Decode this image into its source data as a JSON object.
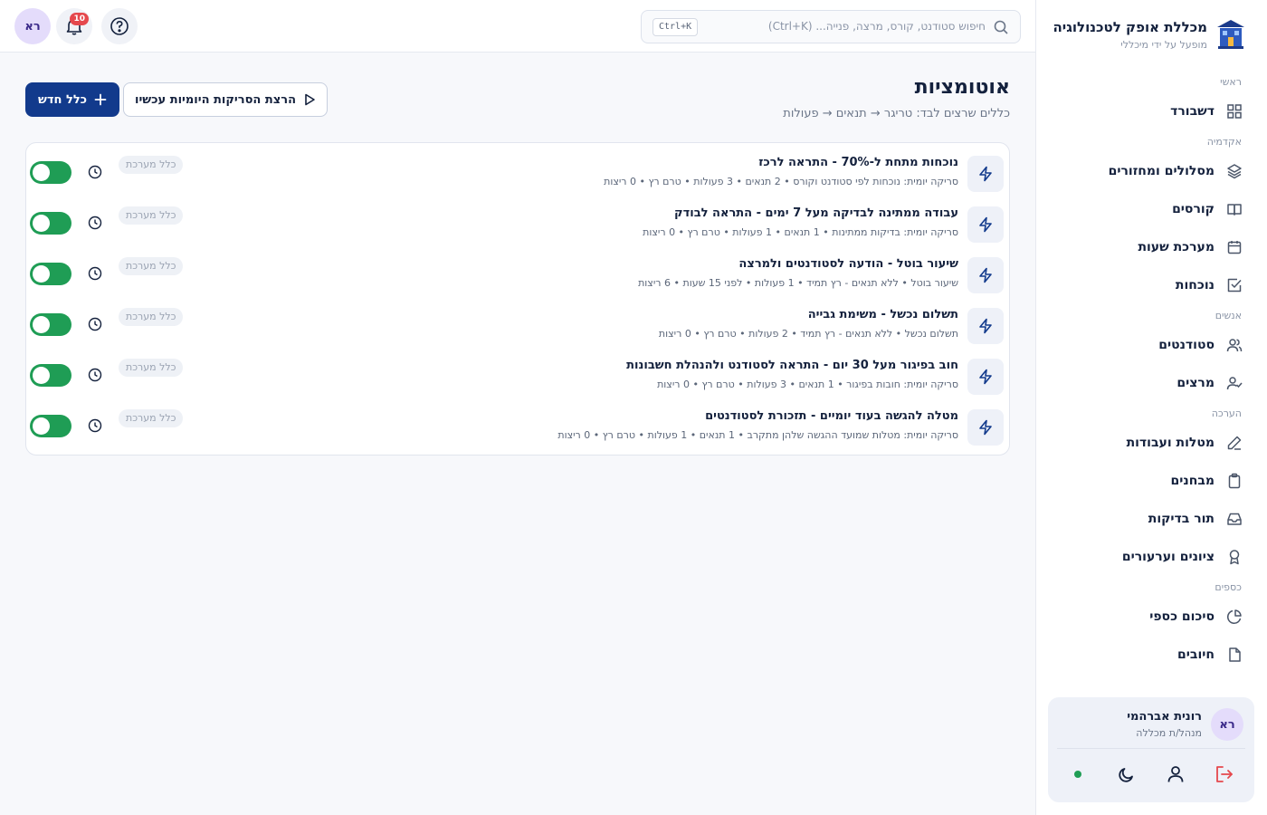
{
  "brand": {
    "title": "מכללת אופק לטכנולוגיה",
    "subtitle": "מופעל על ידי מיכללי"
  },
  "search": {
    "placeholder": "חיפוש סטודנט, קורס, מרצה, פנייה... (Ctrl+K)",
    "shortcut": "Ctrl+K"
  },
  "topbar": {
    "notifications_count": "10",
    "avatar_initials": "רא"
  },
  "page": {
    "title": "אוטומציות",
    "subtitle": "כללים שרצים לבד: טריגר → תנאים → פעולות"
  },
  "actions": {
    "new_rule": "כלל חדש",
    "run_scans": "הרצת הסריקות היומיות עכשיו"
  },
  "rules": [
    {
      "title": "נוכחות מתחת ל-70% - התראה לרכז",
      "meta": "סריקה יומית: נוכחות לפי סטודנט וקורס • 2 תנאים • 3 פעולות • טרם רץ • 0 ריצות",
      "badge": "כלל מערכת",
      "enabled": true
    },
    {
      "title": "עבודה ממתינה לבדיקה מעל 7 ימים - התראה לבודק",
      "meta": "סריקה יומית: בדיקות ממתינות • 1 תנאים • 1 פעולות • טרם רץ • 0 ריצות",
      "badge": "כלל מערכת",
      "enabled": true
    },
    {
      "title": "שיעור בוטל - הודעה לסטודנטים ולמרצה",
      "meta": "שיעור בוטל • ללא תנאים - רץ תמיד • 1 פעולות • לפני 15 שעות • 6 ריצות",
      "badge": "כלל מערכת",
      "enabled": true
    },
    {
      "title": "תשלום נכשל - משימת גבייה",
      "meta": "תשלום נכשל • ללא תנאים - רץ תמיד • 2 פעולות • טרם רץ • 0 ריצות",
      "badge": "כלל מערכת",
      "enabled": true
    },
    {
      "title": "חוב בפיגור מעל 30 יום - התראה לסטודנט ולהנהלת חשבונות",
      "meta": "סריקה יומית: חובות בפיגור • 1 תנאים • 3 פעולות • טרם רץ • 0 ריצות",
      "badge": "כלל מערכת",
      "enabled": true
    },
    {
      "title": "מטלה להגשה בעוד יומיים - תזכורת לסטודנטים",
      "meta": "סריקה יומית: מטלות שמועד ההגשה שלהן מתקרב • 1 תנאים • 1 פעולות • טרם רץ • 0 ריצות",
      "badge": "כלל מערכת",
      "enabled": true
    }
  ],
  "sidebar": {
    "sections": [
      {
        "title": "ראשי",
        "items": [
          {
            "label": "דשבורד",
            "icon": "grid-icon"
          }
        ]
      },
      {
        "title": "אקדמיה",
        "items": [
          {
            "label": "מסלולים ומחזורים",
            "icon": "layers-icon"
          },
          {
            "label": "קורסים",
            "icon": "book-icon"
          },
          {
            "label": "מערכת שעות",
            "icon": "calendar-icon"
          },
          {
            "label": "נוכחות",
            "icon": "checkbox-icon"
          }
        ]
      },
      {
        "title": "אנשים",
        "items": [
          {
            "label": "סטודנטים",
            "icon": "users-icon"
          },
          {
            "label": "מרצים",
            "icon": "user-check-icon"
          }
        ]
      },
      {
        "title": "הערכה",
        "items": [
          {
            "label": "מטלות ועבודות",
            "icon": "pencil-icon"
          },
          {
            "label": "מבחנים",
            "icon": "clipboard-icon"
          },
          {
            "label": "תור בדיקות",
            "icon": "inbox-icon"
          },
          {
            "label": "ציונים וערעורים",
            "icon": "award-icon"
          }
        ]
      },
      {
        "title": "כספים",
        "items": [
          {
            "label": "סיכום כספי",
            "icon": "pie-chart-icon"
          },
          {
            "label": "חיובים",
            "icon": "file-icon"
          }
        ]
      }
    ]
  },
  "user": {
    "initials": "רא",
    "name": "רונית אברהמי",
    "role": "מנהל/ת מכללה"
  },
  "colors": {
    "primary": "#123a8c",
    "toggle_on": "#1f9d55",
    "badge_red": "#e5484d",
    "avatar_bg": "#e4dcfb"
  }
}
